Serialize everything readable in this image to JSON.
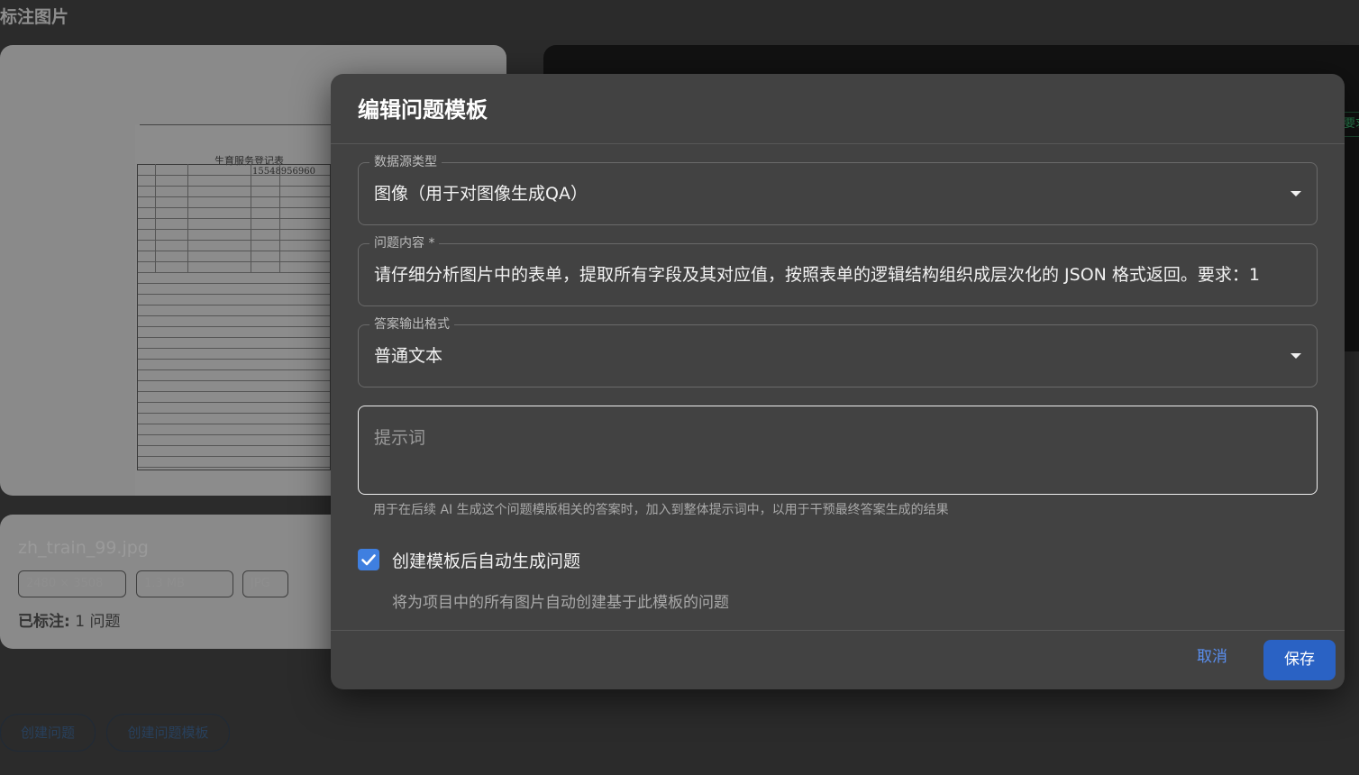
{
  "page": {
    "title": "标注图片"
  },
  "image_card": {
    "doc_title": "生育服务登记表",
    "doc_phone": "15548956960"
  },
  "info_card": {
    "filename": "zh_train_99.jpg",
    "chips": [
      "2480 × 3508",
      "1.3 MB",
      "JPG"
    ],
    "labeled_label": "已标注:",
    "labeled_value": "1 问题"
  },
  "dark_panel": {
    "tag": "要求"
  },
  "bottom_buttons": {
    "create_question": "创建问题",
    "create_template": "创建问题模板"
  },
  "dialog": {
    "title": "编辑问题模板",
    "data_source": {
      "label": "数据源类型",
      "value": "图像（用于对图像生成QA）"
    },
    "question": {
      "label": "问题内容 *",
      "value": "请仔细分析图片中的表单，提取所有字段及其对应值，按照表单的逻辑结构组织成层次化的 JSON 格式返回。要求：1"
    },
    "answer_format": {
      "label": "答案输出格式",
      "value": "普通文本"
    },
    "prompt": {
      "placeholder": "提示词",
      "helper": "用于在后续 AI 生成这个问题模版相关的答案时，加入到整体提示词中，以用于干预最终答案生成的结果"
    },
    "auto_generate": {
      "checked": true,
      "label": "创建模板后自动生成问题",
      "description": "将为项目中的所有图片自动创建基于此模板的问题"
    },
    "actions": {
      "cancel": "取消",
      "save": "保存"
    }
  },
  "colors": {
    "accent": "#3f7fe0",
    "save_button": "#2a62c4",
    "dialog_bg": "#424242",
    "page_bg": "#2b2b2b"
  }
}
